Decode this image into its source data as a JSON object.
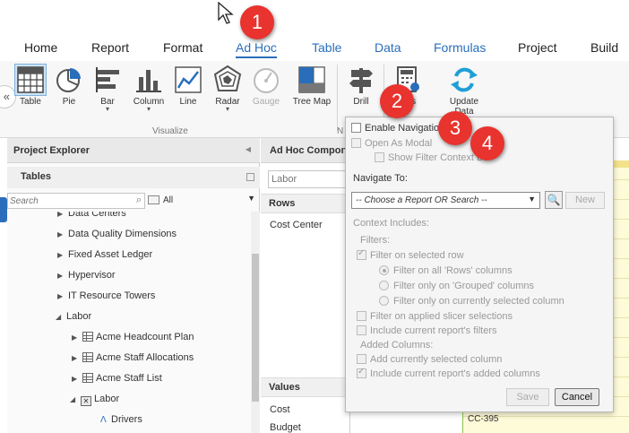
{
  "tabs": [
    {
      "label": "Home"
    },
    {
      "label": "Report"
    },
    {
      "label": "Format"
    },
    {
      "label": "Ad Hoc"
    },
    {
      "label": "Table"
    },
    {
      "label": "Data"
    },
    {
      "label": "Formulas"
    },
    {
      "label": "Project"
    },
    {
      "label": "Build"
    }
  ],
  "ribbon": {
    "buttons": [
      {
        "label": "Table",
        "icon": "table-icon"
      },
      {
        "label": "Pie",
        "icon": "pie-chart-icon"
      },
      {
        "label": "Bar",
        "icon": "bar-chart-icon"
      },
      {
        "label": "Column",
        "icon": "column-chart-icon"
      },
      {
        "label": "Line",
        "icon": "line-chart-icon"
      },
      {
        "label": "Radar",
        "icon": "radar-chart-icon"
      },
      {
        "label": "Gauge",
        "icon": "gauge-icon"
      },
      {
        "label": "Tree Map",
        "icon": "tree-map-icon"
      },
      {
        "label": "Drill",
        "icon": "signpost-icon"
      },
      {
        "label": "ions",
        "icon": "calculator-gear-icon"
      },
      {
        "label": "Update Data",
        "icon": "refresh-icon"
      }
    ],
    "group_visualize": "Visualize",
    "group_n": "N"
  },
  "explorer": {
    "title": "Project Explorer",
    "tables_title": "Tables",
    "search_placeholder": "Search",
    "filter_value": "All",
    "tree": [
      {
        "label": "Data Centers"
      },
      {
        "label": "Data Quality Dimensions"
      },
      {
        "label": "Fixed Asset Ledger"
      },
      {
        "label": "Hypervisor"
      },
      {
        "label": "IT Resource Towers"
      },
      {
        "label": "Labor"
      },
      {
        "label": "Acme Headcount Plan"
      },
      {
        "label": "Acme Staff Allocations"
      },
      {
        "label": "Acme Staff List"
      },
      {
        "label": "Labor"
      },
      {
        "label": "Drivers"
      }
    ]
  },
  "adhoc": {
    "title": "Ad Hoc Compon",
    "label_placeholder": "Labor",
    "rows_title": "Rows",
    "rows_items": [
      "Cost Center"
    ],
    "values_title": "Values",
    "values_items": [
      "Cost",
      "Budget"
    ]
  },
  "grid": {
    "visible_cell": "CC-395"
  },
  "popup": {
    "enable_navigation": "Enable Navigation",
    "open_as_modal": "Open As Modal",
    "show_filter_context": "Show Filter Context Ba",
    "navigate_to_label": "Navigate To:",
    "navigate_placeholder": "-- Choose a Report OR Search --",
    "new_label": "New",
    "context_includes": "Context Includes:",
    "filters_label": "Filters:",
    "filter_on_selected_row": "Filter on selected row",
    "radio_all_rows": "Filter on all 'Rows' columns",
    "radio_grouped": "Filter only on 'Grouped' columns",
    "radio_current": "Filter only on currently selected column",
    "filter_slicer": "Filter on applied slicer selections",
    "include_report_filters": "Include current report's filters",
    "added_columns_label": "Added Columns:",
    "add_selected_column": "Add currently selected column",
    "include_added_columns": "Include current report's added columns",
    "save_label": "Save",
    "cancel_label": "Cancel"
  },
  "callouts": [
    "1",
    "2",
    "3",
    "4"
  ]
}
